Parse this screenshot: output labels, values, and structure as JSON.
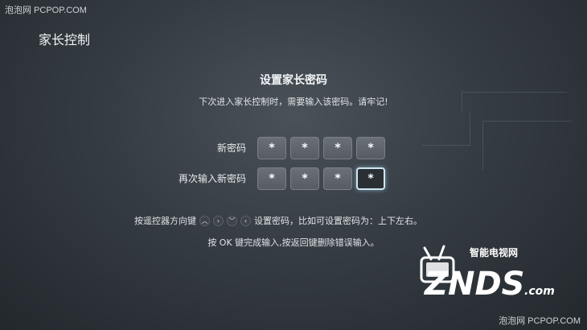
{
  "watermark": {
    "top": "泡泡网 PCPOP.COM",
    "bottom": "泡泡网 PCPOP.COM"
  },
  "page": {
    "title": "家长控制"
  },
  "setup": {
    "title": "设置家长密码",
    "subtitle": "下次进入家长控制时，需要输入该密码。请牢记!",
    "new_password": {
      "label": "新密码",
      "digits": [
        "*",
        "*",
        "*",
        "*"
      ]
    },
    "confirm_password": {
      "label": "再次输入新密码",
      "digits": [
        "*",
        "*",
        "*",
        "*"
      ],
      "active_index": 3
    }
  },
  "hints": {
    "line1_prefix": "按遥控器方向键",
    "arrow_icons": [
      "arrow-up-icon",
      "arrow-right-icon",
      "arrow-down-icon",
      "arrow-left-icon"
    ],
    "arrow_glyphs": [
      "︿",
      "›",
      "﹀",
      "‹"
    ],
    "line1_suffix": "设置密码，比如可设置密码为：上下左右。",
    "line2": "按 OK 键完成输入,按返回键删除错误输入。"
  },
  "logo": {
    "text_cn": "智能电视网",
    "text_main": "ZNDS",
    "text_suffix": ".com"
  },
  "colors": {
    "active_border": "#cfe6f2",
    "box_fill": "#5f656b",
    "accent_logo": "#ffffff"
  }
}
